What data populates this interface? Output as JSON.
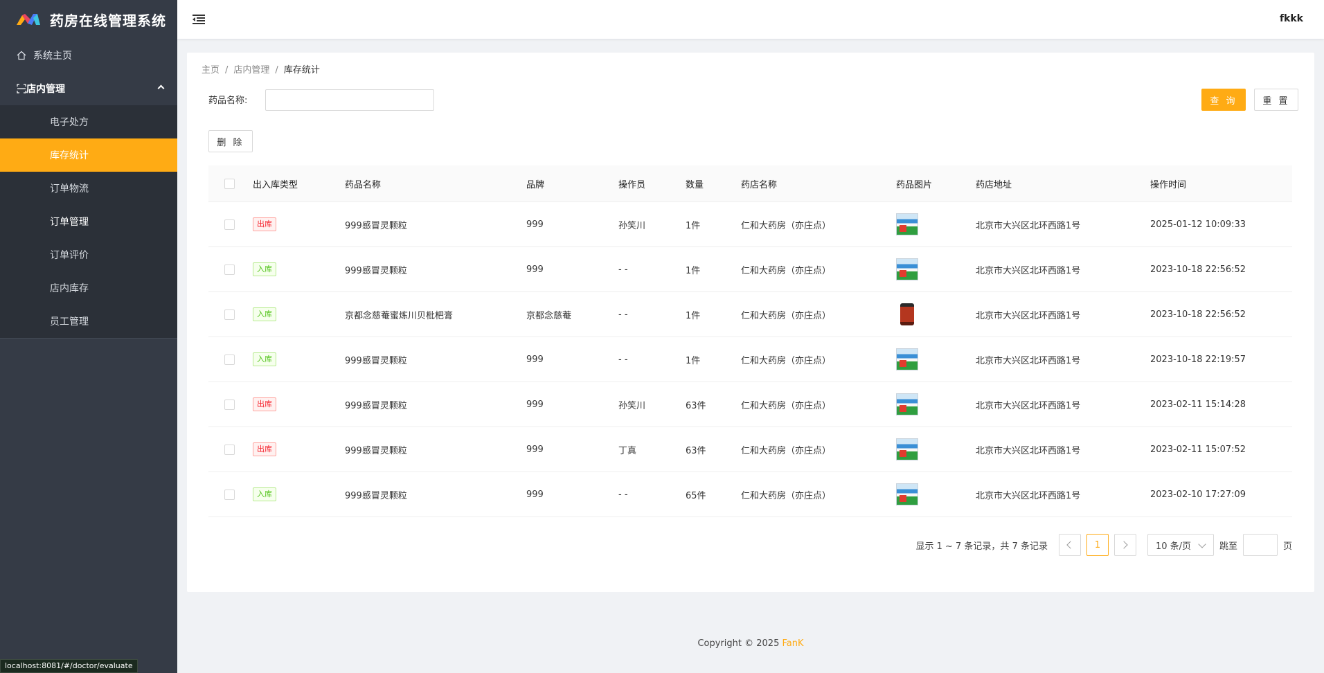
{
  "app": {
    "title": "药房在线管理系统",
    "accent_color": "#ffab14"
  },
  "sidebar": {
    "home_label": "系统主页",
    "group_label": "店内管理",
    "items": [
      {
        "label": "电子处方"
      },
      {
        "label": "库存统计"
      },
      {
        "label": "订单物流"
      },
      {
        "label": "订单管理"
      },
      {
        "label": "订单评价"
      },
      {
        "label": "店内库存"
      },
      {
        "label": "员工管理"
      }
    ]
  },
  "header": {
    "user": "fkkk"
  },
  "breadcrumb": [
    "主页",
    "店内管理",
    "库存统计"
  ],
  "search": {
    "label": "药品名称:",
    "value": "",
    "placeholder": ""
  },
  "buttons": {
    "query": "查 询",
    "reset": "重 置",
    "delete": "删 除"
  },
  "table": {
    "headers": [
      "出入库类型",
      "药品名称",
      "品牌",
      "操作员",
      "数量",
      "药店名称",
      "药品图片",
      "药店地址",
      "操作时间"
    ],
    "rows": [
      {
        "type": "出库",
        "kind": "out",
        "name": "999感冒灵颗粒",
        "brand": "999",
        "operator": "孙笑川",
        "qty": "1件",
        "store": "仁和大药房（亦庄点）",
        "image": "medicine-box",
        "address": "北京市大兴区北环西路1号",
        "time": "2025-01-12 10:09:33"
      },
      {
        "type": "入库",
        "kind": "in",
        "name": "999感冒灵颗粒",
        "brand": "999",
        "operator": "- -",
        "qty": "1件",
        "store": "仁和大药房（亦庄点）",
        "image": "medicine-box",
        "address": "北京市大兴区北环西路1号",
        "time": "2023-10-18 22:56:52"
      },
      {
        "type": "入库",
        "kind": "in",
        "name": "京都念慈菴蜜炼川贝枇杷膏",
        "brand": "京都念慈菴",
        "operator": "- -",
        "qty": "1件",
        "store": "仁和大药房（亦庄点）",
        "image": "syrup-bottle",
        "address": "北京市大兴区北环西路1号",
        "time": "2023-10-18 22:56:52"
      },
      {
        "type": "入库",
        "kind": "in",
        "name": "999感冒灵颗粒",
        "brand": "999",
        "operator": "- -",
        "qty": "1件",
        "store": "仁和大药房（亦庄点）",
        "image": "medicine-box",
        "address": "北京市大兴区北环西路1号",
        "time": "2023-10-18 22:19:57"
      },
      {
        "type": "出库",
        "kind": "out",
        "name": "999感冒灵颗粒",
        "brand": "999",
        "operator": "孙笑川",
        "qty": "63件",
        "store": "仁和大药房（亦庄点）",
        "image": "medicine-box",
        "address": "北京市大兴区北环西路1号",
        "time": "2023-02-11 15:14:28"
      },
      {
        "type": "出库",
        "kind": "out",
        "name": "999感冒灵颗粒",
        "brand": "999",
        "operator": "丁真",
        "qty": "63件",
        "store": "仁和大药房（亦庄点）",
        "image": "medicine-box",
        "address": "北京市大兴区北环西路1号",
        "time": "2023-02-11 15:07:52"
      },
      {
        "type": "入库",
        "kind": "in",
        "name": "999感冒灵颗粒",
        "brand": "999",
        "operator": "- -",
        "qty": "65件",
        "store": "仁和大药房（亦庄点）",
        "image": "medicine-box",
        "address": "北京市大兴区北环西路1号",
        "time": "2023-02-10 17:27:09"
      }
    ]
  },
  "pagination": {
    "summary": "显示 1 ~ 7 条记录，共 7 条记录",
    "current_page": "1",
    "page_size": "10 条/页",
    "jump_label": "跳至",
    "page_suffix": "页"
  },
  "footer": {
    "copyright": "Copyright © 2025 ",
    "brand": "FanK"
  },
  "status_bar": "localhost:8081/#/doctor/evaluate"
}
